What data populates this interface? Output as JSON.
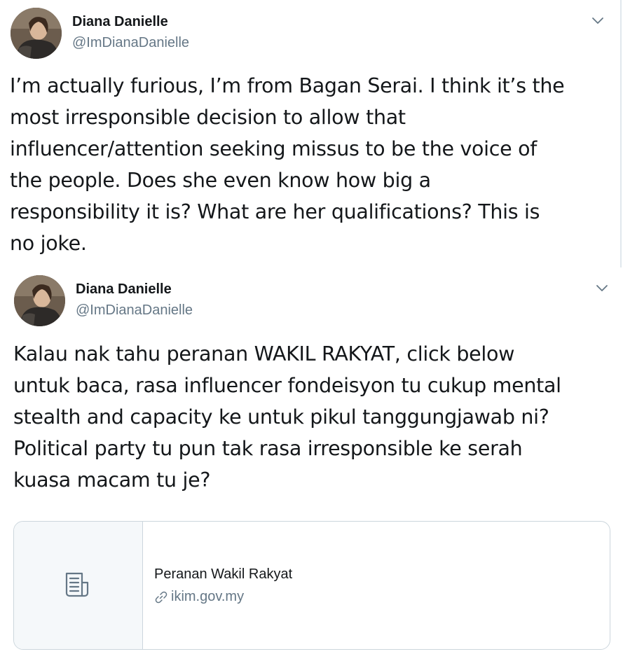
{
  "tweets": [
    {
      "author_name": "Diana Danielle",
      "author_handle": "@ImDianaDanielle",
      "text": "I’m actually furious, I’m from Bagan Serai. I think it’s the\nmost irresponsible decision to allow that\ninfluencer/attention seeking missus to be the voice of\nthe people. Does she even know how big a\nresponsibility it is? What are her qualifications? This is\nno joke."
    },
    {
      "author_name": "Diana Danielle",
      "author_handle": "@ImDianaDanielle",
      "text": "Kalau nak tahu peranan WAKIL RAKYAT, click below\nuntuk baca, rasa influencer fondeisyon tu cukup mental\nstealth and capacity ke untuk pikul tanggungjawab ni?\nPolitical party tu pun tak rasa irresponsible ke serah\nkuasa macam tu je?",
      "card": {
        "title": "Peranan Wakil Rakyat",
        "domain": "ikim.gov.my"
      }
    }
  ],
  "icons": {
    "caret": "chevron-down-icon",
    "card_thumb": "document-icon",
    "link": "link-icon"
  },
  "colors": {
    "text_primary": "#14171a",
    "text_secondary": "#657786",
    "border": "#ccd6dd",
    "card_thumb_bg": "#f5f8fa"
  }
}
